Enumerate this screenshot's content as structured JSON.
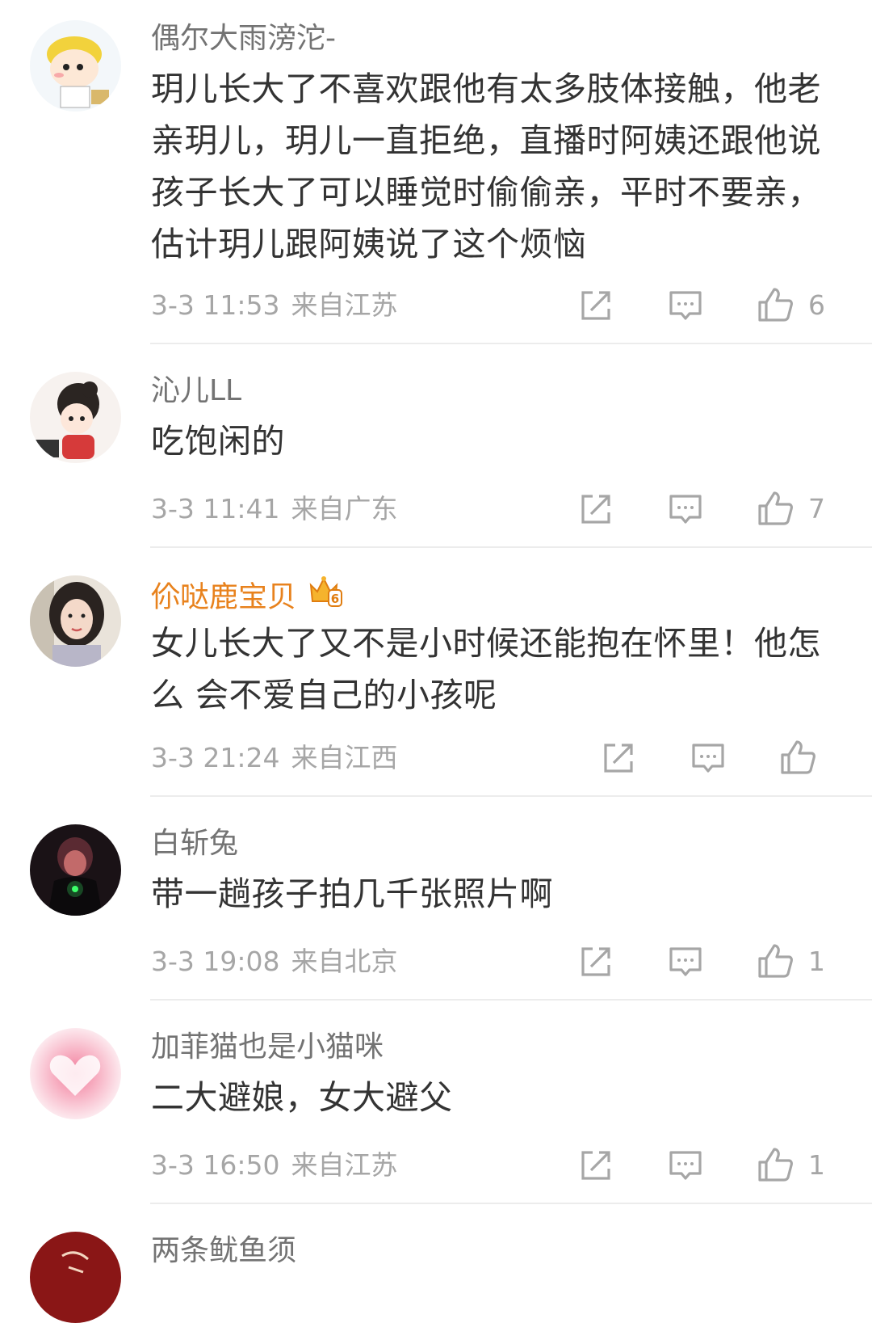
{
  "comments": [
    {
      "username": "偶尔大雨滂沱-",
      "text": "玥儿长大了不喜欢跟他有太多肢体接触，他老亲玥儿，玥儿一直拒绝，直播时阿姨还跟他说孩子长大了可以睡觉时偷偷亲，平时不要亲，估计玥儿跟阿姨说了这个烦恼",
      "time": "3-3 11:53",
      "location": "来自江苏",
      "likes": "6"
    },
    {
      "username": "沁儿LL",
      "text": "吃饱闲的",
      "time": "3-3 11:41",
      "location": "来自广东",
      "likes": "7"
    },
    {
      "username": "伱哒鹿宝贝",
      "vip_badge": "6",
      "text": "女儿长大了又不是小时候还能抱在怀里！他怎么 会不爱自己的小孩呢",
      "time": "3-3 21:24",
      "location": "来自江西",
      "likes": ""
    },
    {
      "username": "白斩兔",
      "text": "带一趟孩子拍几千张照片啊",
      "time": "3-3 19:08",
      "location": "来自北京",
      "likes": "1"
    },
    {
      "username": "加菲猫也是小猫咪",
      "text": "二大避娘，女大避父",
      "time": "3-3 16:50",
      "location": "来自江苏",
      "likes": "1"
    },
    {
      "username": "两条鱿鱼须"
    }
  ],
  "colors": {
    "username": "#737373",
    "vip_username": "#e8821d",
    "text": "#333333",
    "meta": "#a6a6a6",
    "divider": "#ececec"
  },
  "icons": [
    "share-icon",
    "comment-icon",
    "like-icon"
  ]
}
